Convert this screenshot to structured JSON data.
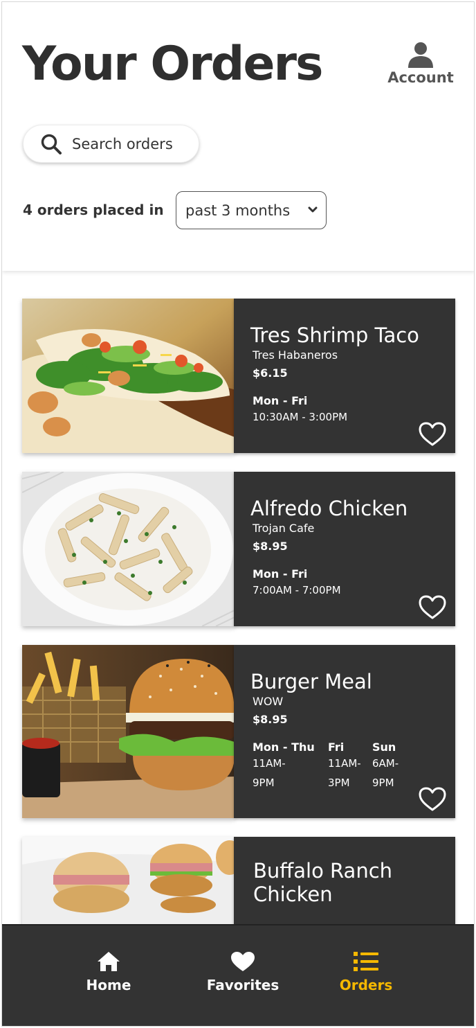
{
  "header": {
    "title": "Your Orders",
    "account_label": "Account"
  },
  "search": {
    "placeholder": "Search orders"
  },
  "filter": {
    "count_label": "4 orders placed in",
    "selected_period": "past 3 months"
  },
  "orders": [
    {
      "name": "Tres Shrimp Taco",
      "restaurant": "Tres Habaneros",
      "price": "$6.15",
      "hours": [
        {
          "days": "Mon - Fri",
          "time": "10:30AM - 3:00PM"
        }
      ]
    },
    {
      "name": "Alfredo Chicken",
      "restaurant": "Trojan Cafe",
      "price": "$8.95",
      "hours": [
        {
          "days": "Mon - Fri",
          "time": "7:00AM - 7:00PM"
        }
      ]
    },
    {
      "name": "Burger Meal",
      "restaurant": "WOW",
      "price": "$8.95",
      "hours": [
        {
          "days": "Mon - Thu",
          "time_line1": "11AM-",
          "time_line2": "9PM"
        },
        {
          "days": "Fri",
          "time_line1": "11AM-",
          "time_line2": "3PM"
        },
        {
          "days": "Sun",
          "time_line1": "6AM-",
          "time_line2": "9PM"
        }
      ]
    },
    {
      "name_line1": "Buffalo Ranch",
      "name_line2": "Chicken"
    }
  ],
  "nav": {
    "items": [
      {
        "label": "Home",
        "icon": "home-icon"
      },
      {
        "label": "Favorites",
        "icon": "heart-icon"
      },
      {
        "label": "Orders",
        "icon": "list-icon",
        "active": true
      }
    ]
  },
  "colors": {
    "card_bg": "#333333",
    "nav_bg": "#333333",
    "accent": "#f5b800",
    "text_dark": "#333333"
  }
}
